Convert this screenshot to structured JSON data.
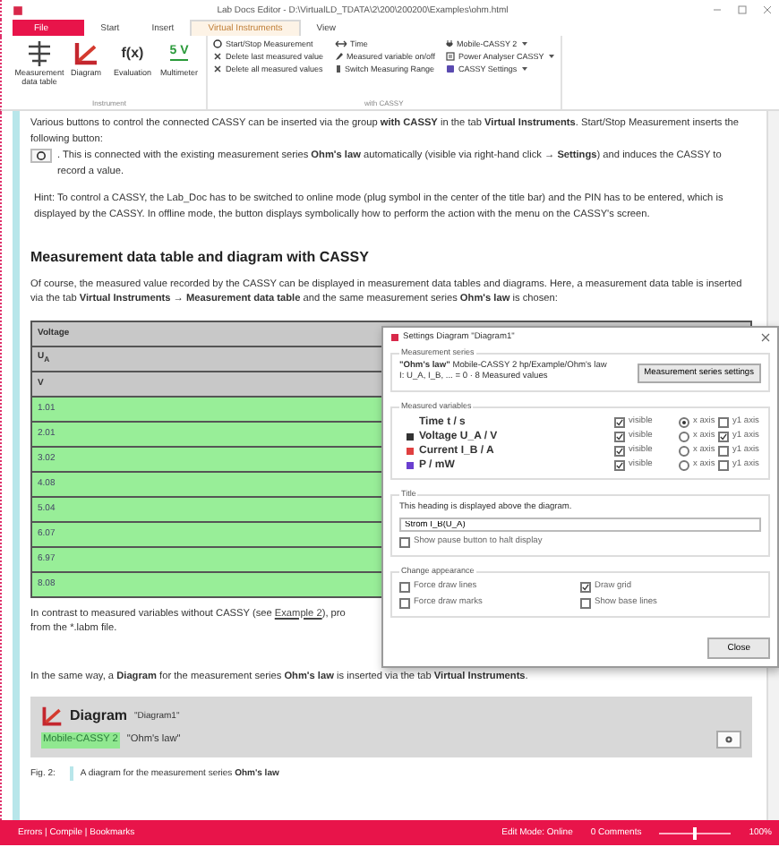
{
  "window": {
    "title": "Lab Docs Editor - D:\\VirtualLD_TDATA\\2\\200\\200200\\Examples\\ohm.html"
  },
  "tabs": [
    {
      "label": "File",
      "kind": "app",
      "selected": false
    },
    {
      "label": "Start",
      "kind": "normal",
      "selected": false
    },
    {
      "label": "Insert",
      "kind": "normal",
      "selected": false
    },
    {
      "label": "Virtual Instruments",
      "kind": "context",
      "selected": true
    },
    {
      "label": "View",
      "kind": "normal",
      "selected": false
    }
  ],
  "ribbon": {
    "groups": [
      {
        "label": "Instrument",
        "buttons": [
          {
            "label": "Measurement data table",
            "kind": "table"
          },
          {
            "label": "Diagram",
            "kind": "diagram"
          },
          {
            "label": "Evaluation",
            "kind": "glyph",
            "glyph": "f(x)"
          },
          {
            "label": "Multimeter",
            "kind": "meter",
            "glyph": "5 V"
          }
        ]
      },
      {
        "label": "with CASSY",
        "columns": [
          [
            {
              "label": "Start/Stop Measurement",
              "kind": "circle"
            },
            {
              "label": "Delete last measured value",
              "kind": "cross"
            },
            {
              "label": "Delete all measured values",
              "kind": "cross"
            }
          ],
          [
            {
              "label": "Time",
              "kind": "arrow"
            },
            {
              "label": "Measured variable on/off",
              "kind": "pen"
            },
            {
              "label": "Switch Measuring Range",
              "kind": "range"
            }
          ],
          [
            {
              "label": "Mobile-CASSY 2",
              "kind": "plug",
              "dropdown": true
            },
            {
              "label": "Power Analyser CASSY",
              "kind": "analyser",
              "dropdown": true
            },
            {
              "label": "CASSY Settings",
              "kind": "settings",
              "dropdown": true
            }
          ]
        ]
      }
    ]
  },
  "content": {
    "intro": {
      "before": "Various buttons to control the connected CASSY can be inserted via the group **with CASSY** in the tab **Virtual Instruments**. Start/Stop Measurement inserts the following button:",
      "after": ". This is connected with the existing measurement series **Ohm's law** automatically (visible via right-hand click → **Settings**) and induces the CASSY to record a value."
    },
    "hint": "Hint: To control a CASSY, the Lab_Doc has to be switched to online mode (plug symbol in the center of the title bar) and the PIN has to be entered, which is displayed by the CASSY. In offline mode, the button displays symbolically how to perform the action with the menu on the CASSY's screen.",
    "heading": "Measurement data table and diagram with CASSY",
    "table_intro": "Of course, the measured value recorded by the CASSY can be displayed in measurement data tables and diagrams. Here, a measurement data table is inserted via the tab **Virtual Instruments** → **Measurement data table** and the same measurement series **Ohm's law** is chosen:",
    "table": {
      "header": [
        "Voltage",
        "U$_{A}$",
        "V"
      ],
      "rows": [
        "1.01",
        "2.01",
        "3.02",
        "4.08",
        "5.04",
        "6.07",
        "6.97",
        "8.08"
      ]
    },
    "contrast": {
      "before": "In contrast to measured variables without CASSY (see ",
      "link": "Example 2",
      "after": "), pro",
      "line2": "from the *.labm file."
    },
    "diagram_intro": "In the same way, a **Diagram** for the measurement series **Ohm's law** is inserted via the tab **Virtual Instruments**.",
    "diagram_card": {
      "title": "Diagram",
      "name": "\"Diagram1\"",
      "device": "Mobile-CASSY 2",
      "series": "\"Ohm's law\""
    },
    "caption": {
      "label": "Fig. 2:",
      "text": "A diagram for the measurement series **Ohm's law**"
    }
  },
  "dialog": {
    "title": "Settings Diagram \"Diagram1\"",
    "series_group": "Measurement series",
    "series_name": "\"Ohm's law\"",
    "series_info": "Mobile-CASSY 2 hp/Example/Ohm's law",
    "series_detail": "I: U_A, I_B, ... = 0 · 8 Measured values",
    "series_button": "Measurement series settings",
    "variables_group": "Measured variables",
    "variables": [
      {
        "label": "Time t / s",
        "visible": true,
        "visible_text": "visible",
        "x_axis": true,
        "x_text": "x axis",
        "y1_axis": false,
        "y1_text": "y1 axis"
      },
      {
        "label": "Voltage U_A / V",
        "color": "#333333",
        "visible": true,
        "visible_text": "visible",
        "x_axis": false,
        "x_text": "x axis",
        "y1_axis": true,
        "y1_text": "y1 axis"
      },
      {
        "label": "Current I_B / A",
        "color": "#e04040",
        "visible": true,
        "visible_text": "visible",
        "x_axis": false,
        "x_text": "x axis",
        "y1_axis": false,
        "y1_text": "y1 axis"
      },
      {
        "label": "P / mW",
        "color": "#6a3fd0",
        "visible": true,
        "visible_text": "visible",
        "x_axis": false,
        "x_text": "x axis",
        "y1_axis": false,
        "y1_text": "y1 axis"
      }
    ],
    "title_group": "Title",
    "title_hint": "This heading is displayed above the diagram.",
    "title_value": "Strom I_B(U_A)",
    "pause": {
      "label": "Show pause button to halt display",
      "checked": false
    },
    "appearance_group": "Change appearance",
    "appearance": [
      {
        "label": "Force draw lines",
        "checked": false
      },
      {
        "label": "Draw grid",
        "checked": true
      },
      {
        "label": "Force draw marks",
        "checked": false
      },
      {
        "label": "Show base lines",
        "checked": false
      }
    ],
    "close": "Close"
  },
  "status_bar": {
    "left": "Errors | Compile | Bookmarks",
    "mode": "Edit Mode: Online",
    "comments": "0 Comments",
    "zoom": {
      "level": 0.5
    },
    "zoom_text": "100%"
  }
}
